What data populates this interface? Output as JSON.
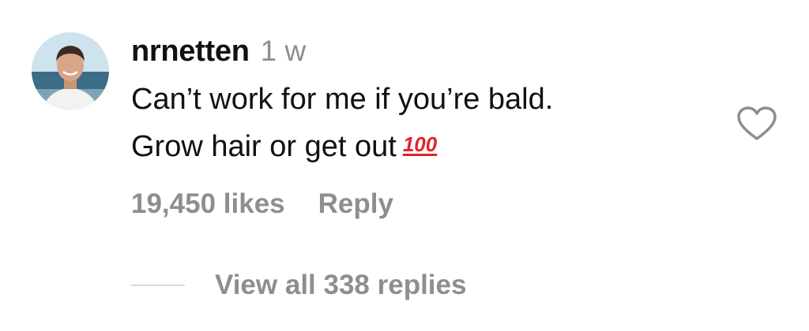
{
  "comment": {
    "username": "nrnetten",
    "time_ago": "1 w",
    "text_line_1": "Can’t work for me if you’re bald.",
    "text_line_2": "Grow hair or get out",
    "emoji": "100",
    "emoji_name": "hundred-points-emoji",
    "likes": "19,450 likes",
    "reply_label": "Reply",
    "like_icon": "heart-outline-icon",
    "view_replies": "View all 338 replies"
  },
  "colors": {
    "text_primary": "#111111",
    "text_secondary": "#8e8e8e",
    "emoji_red": "#e0242b",
    "divider": "#d9d9d9"
  }
}
